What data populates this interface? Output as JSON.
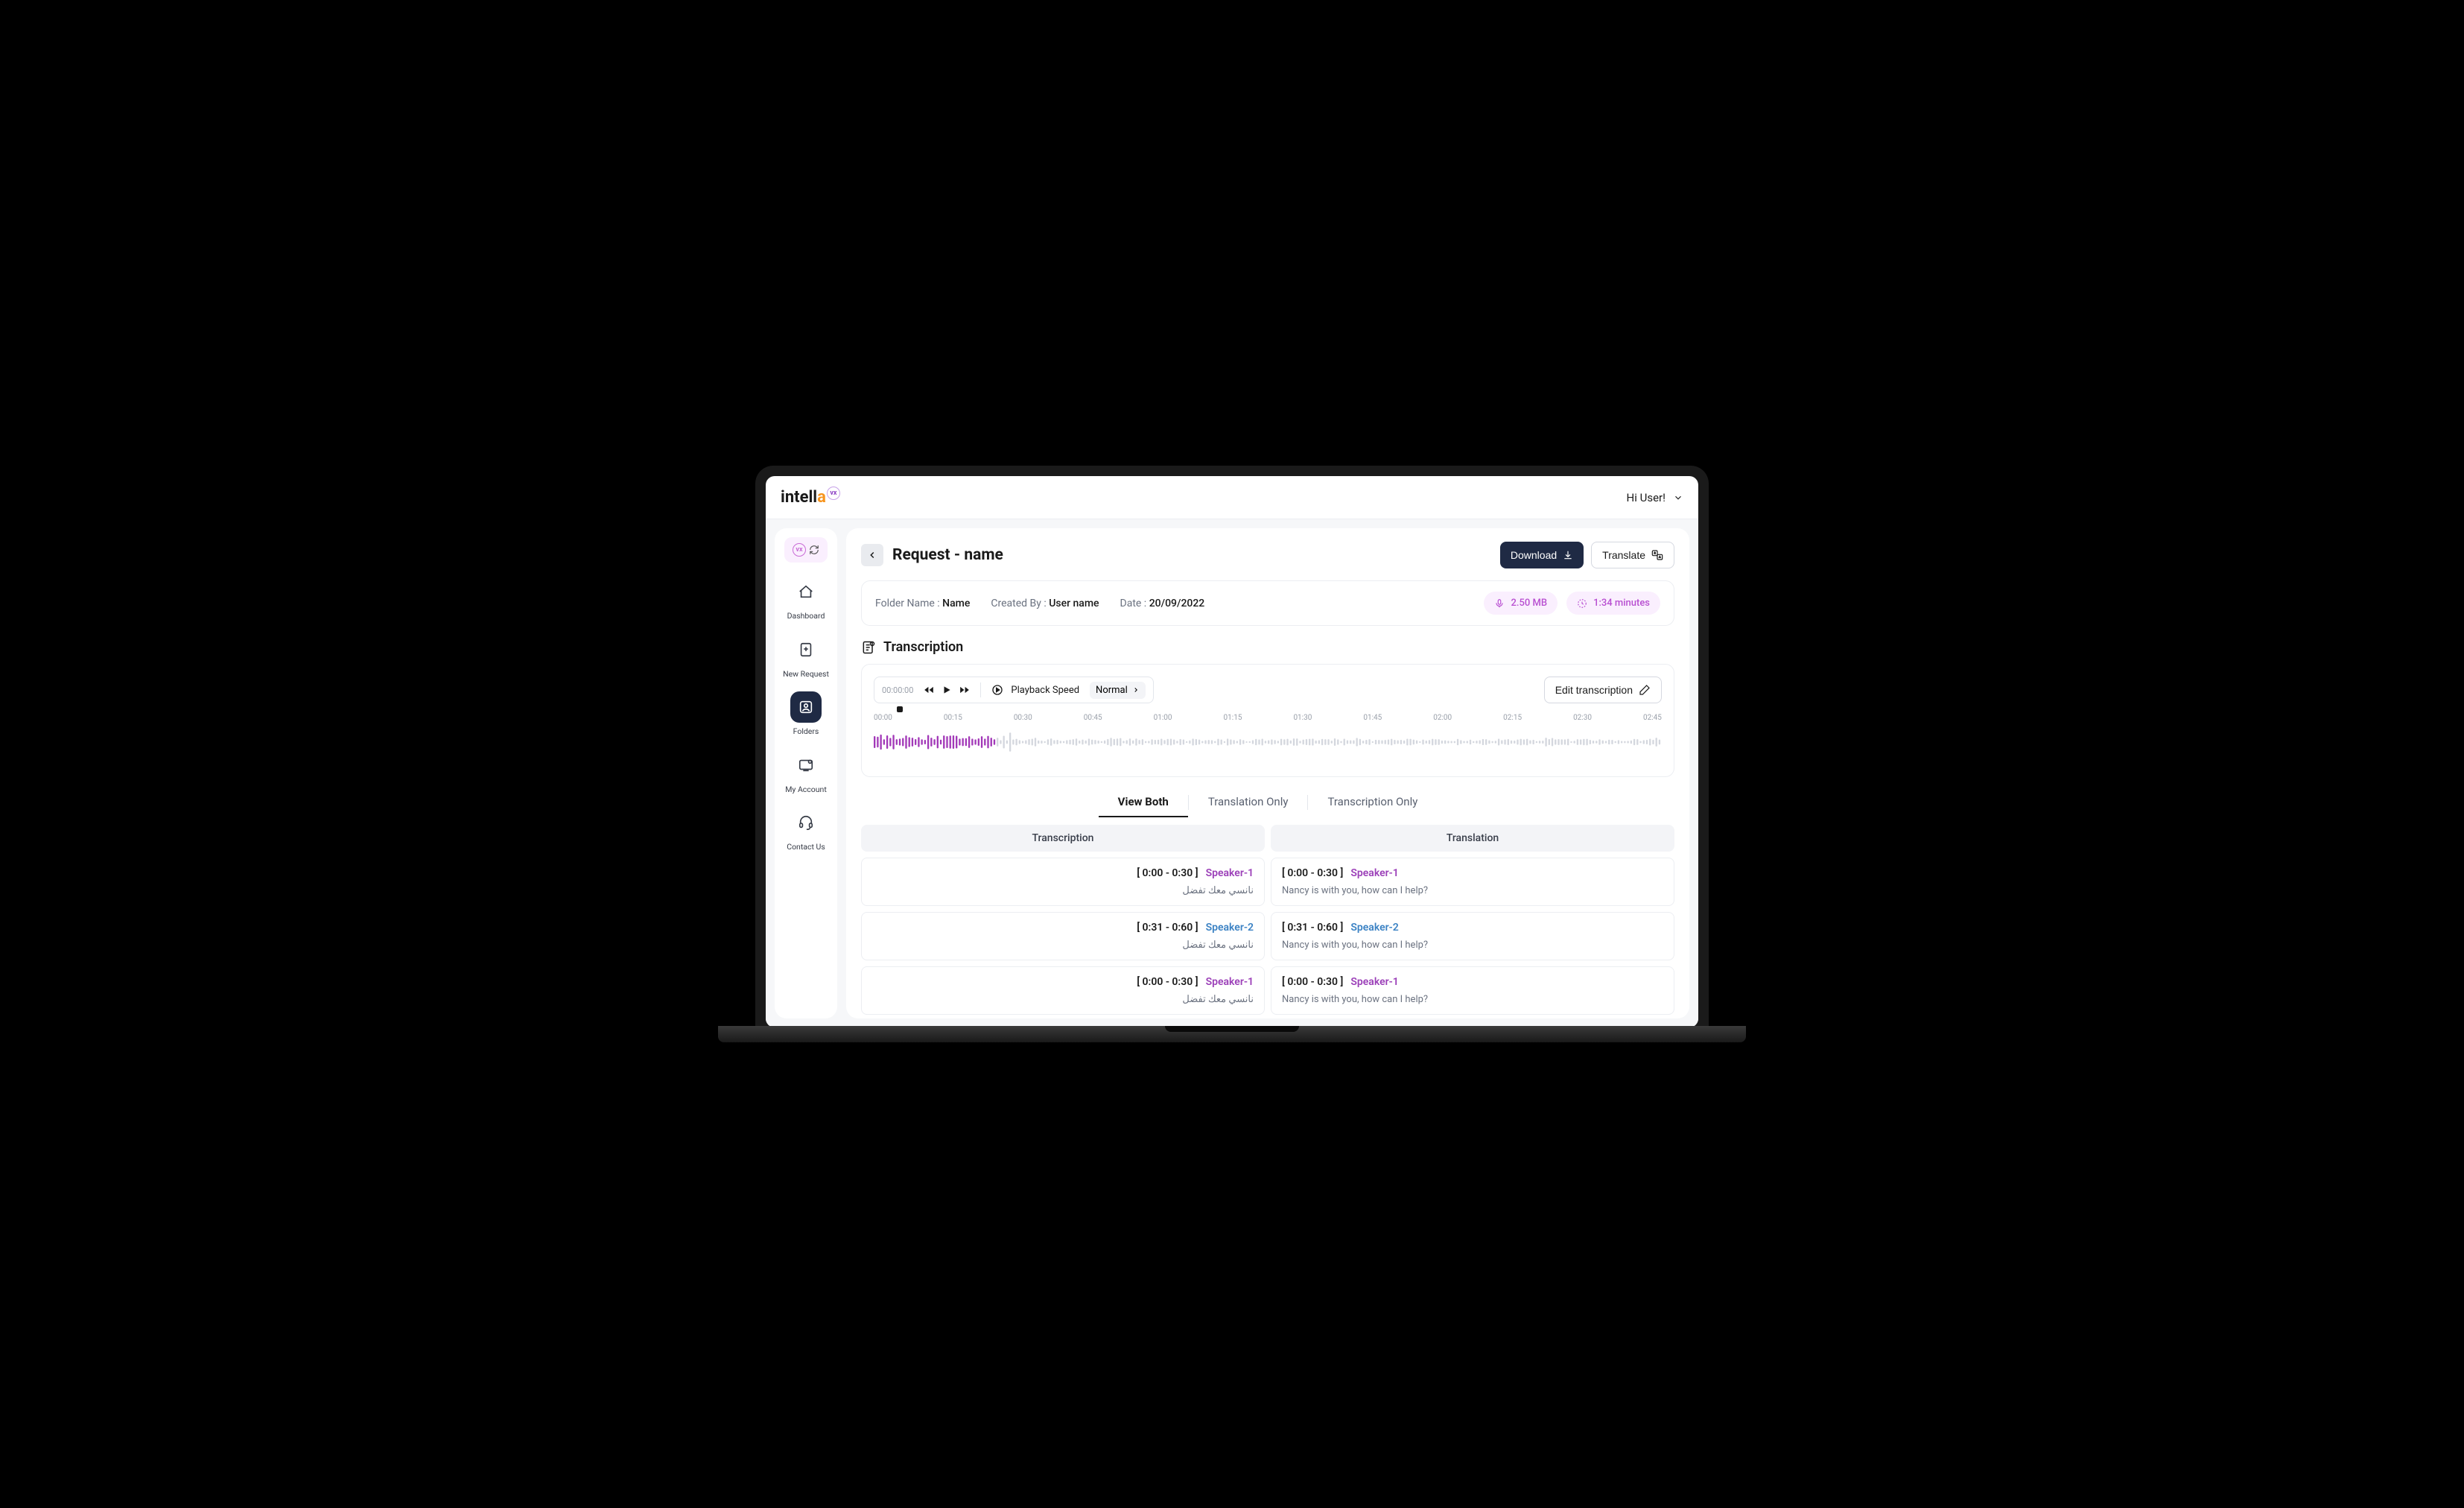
{
  "brand": {
    "name": "intella",
    "badge": "vx"
  },
  "user": {
    "greeting": "Hi User!"
  },
  "sidebar": {
    "items": [
      {
        "label": "Dashboard"
      },
      {
        "label": "New Request"
      },
      {
        "label": "Folders"
      },
      {
        "label": "My Account"
      },
      {
        "label": "Contact Us"
      }
    ]
  },
  "page": {
    "title": "Request - name",
    "download": "Download",
    "translate": "Translate"
  },
  "meta": {
    "folder_label": "Folder Name :",
    "folder_value": "Name",
    "created_label": "Created By :",
    "created_value": "User name",
    "date_label": "Date :",
    "date_value": "20/09/2022",
    "size": "2.50 MB",
    "duration": "1:34 minutes"
  },
  "transcription": {
    "section_title": "Transcription",
    "current_time": "00:00:00",
    "playback_label": "Playback Speed",
    "speed": "Normal",
    "edit_label": "Edit transcription",
    "timeline": [
      "00:00",
      "00:15",
      "00:30",
      "00:45",
      "01:00",
      "01:15",
      "01:30",
      "01:45",
      "02:00",
      "02:15",
      "02:30",
      "02:45"
    ]
  },
  "tabs": {
    "view_both": "View Both",
    "translation_only": "Translation Only",
    "transcription_only": "Transcription Only"
  },
  "columns": {
    "transcription": "Transcription",
    "translation": "Translation"
  },
  "segments": [
    {
      "range": "[ 0:00 - 0:30 ]",
      "speaker": "Speaker-1",
      "speaker_class": "s1",
      "transcription": "نانسي معك تفضل",
      "translation": "Nancy is with you, how can I help?"
    },
    {
      "range": "[ 0:31 - 0:60 ]",
      "speaker": "Speaker-2",
      "speaker_class": "s2",
      "transcription": "نانسي معك تفضل",
      "translation": "Nancy is with you, how can I help?"
    },
    {
      "range": "[ 0:00 - 0:30 ]",
      "speaker": "Speaker-1",
      "speaker_class": "s1",
      "transcription": "نانسي معك تفضل",
      "translation": "Nancy is with you, how can I help?"
    }
  ]
}
